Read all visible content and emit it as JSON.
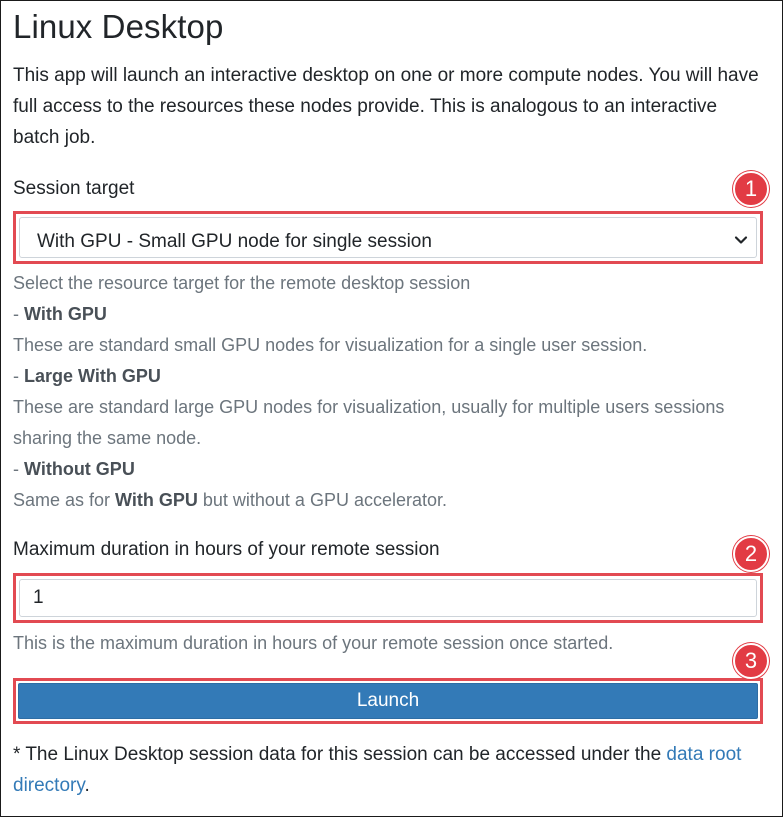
{
  "page": {
    "title": "Linux Desktop",
    "intro": "This app will launch an interactive desktop on one or more compute nodes. You will have full access to the resources these nodes provide. This is analogous to an interactive batch job."
  },
  "session_target": {
    "label": "Session target",
    "selected": "With GPU - Small GPU node for single session",
    "help_intro": "Select the resource target for the remote desktop session",
    "options_help": [
      {
        "dash": "- ",
        "name": "With GPU",
        "desc": "These are standard small GPU nodes for visualization for a single user session."
      },
      {
        "dash": "- ",
        "name": "Large With GPU",
        "desc": "These are standard large GPU nodes for visualization, usually for multiple users sessions sharing the same node."
      },
      {
        "dash": "- ",
        "name": "Without GPU",
        "desc_pre": "Same as for ",
        "desc_bold": "With GPU",
        "desc_post": " but without a GPU accelerator."
      }
    ]
  },
  "duration": {
    "label": "Maximum duration in hours of your remote session",
    "value": "1",
    "help": "This is the maximum duration in hours of your remote session once started."
  },
  "launch": {
    "label": "Launch"
  },
  "footnote": {
    "text": "* The Linux Desktop session data for this session can be accessed under the ",
    "link": "data root directory",
    "end": "."
  },
  "annotations": {
    "badge_1": "1",
    "badge_2": "2",
    "badge_3": "3",
    "color": "#e23b44"
  },
  "icons": {
    "select_arrow": "chevron-down-icon"
  },
  "colors": {
    "primary": "#337ab7",
    "muted_text": "#6c757d",
    "highlight_border": "#e24a52"
  }
}
